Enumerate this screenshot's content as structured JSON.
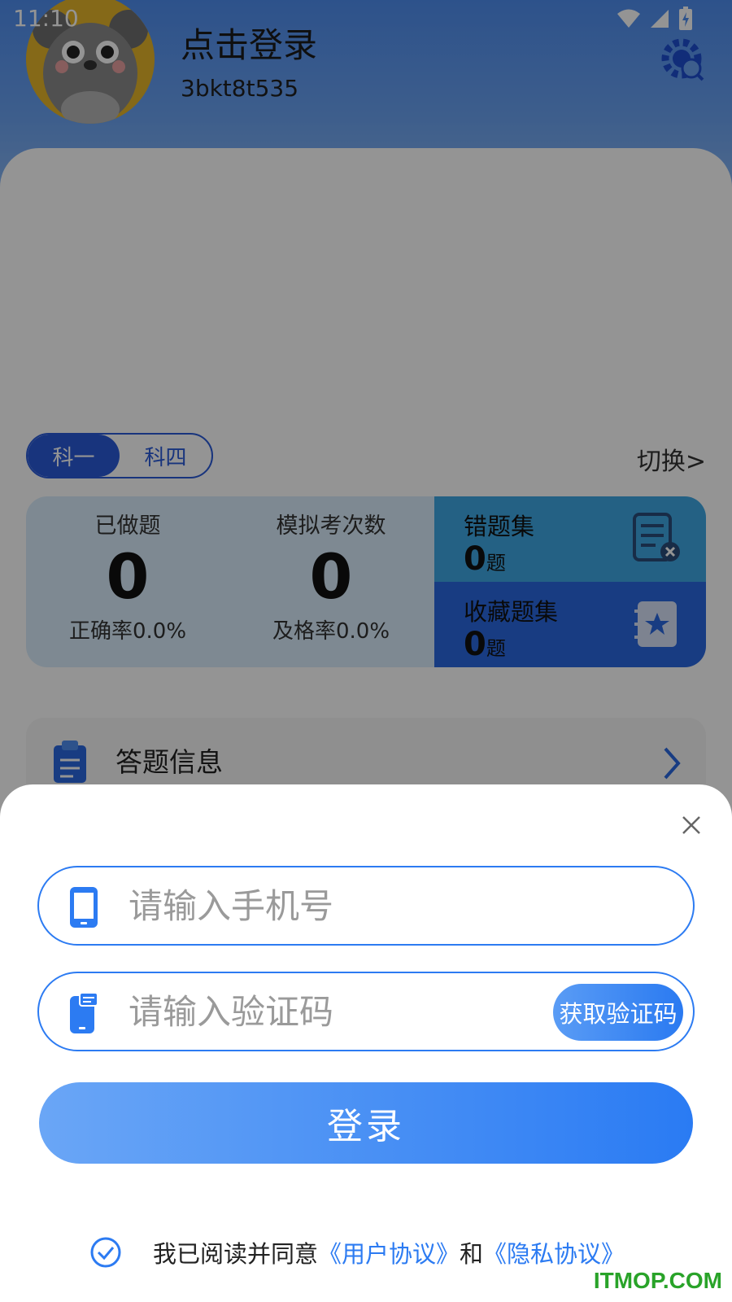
{
  "status_bar": {
    "time": "11:10"
  },
  "profile": {
    "name": "点击登录",
    "user_id": "3bkt8t535"
  },
  "subject_toggle": {
    "options": [
      "科一",
      "科四"
    ],
    "selected": "科一"
  },
  "switch_link": "切换>",
  "stats": {
    "done": {
      "label": "已做题",
      "value": "0",
      "sub": "正确率0.0%"
    },
    "mock": {
      "label": "模拟考次数",
      "value": "0",
      "sub": "及格率0.0%"
    },
    "wrong_set": {
      "title": "错题集",
      "count": "0",
      "unit": "题"
    },
    "favorites": {
      "title": "收藏题集",
      "count": "0",
      "unit": "题"
    }
  },
  "answer_info": {
    "label": "答题信息"
  },
  "login_sheet": {
    "phone_placeholder": "请输入手机号",
    "code_placeholder": "请输入验证码",
    "get_code_label": "获取验证码",
    "login_label": "登录",
    "agreement": {
      "prefix": "我已阅读并同意",
      "user_agreement": "《用户协议》",
      "and": "和",
      "privacy_agreement": "《隐私协议》"
    }
  },
  "watermark": "ITMOP.COM",
  "colors": {
    "accent": "#2c7bf2",
    "header_blue": "#4f8ef0",
    "wrong_set_bg": "#3ea8e4",
    "favorites_bg": "#2a68e0",
    "subject_active": "#2a5bd7"
  }
}
